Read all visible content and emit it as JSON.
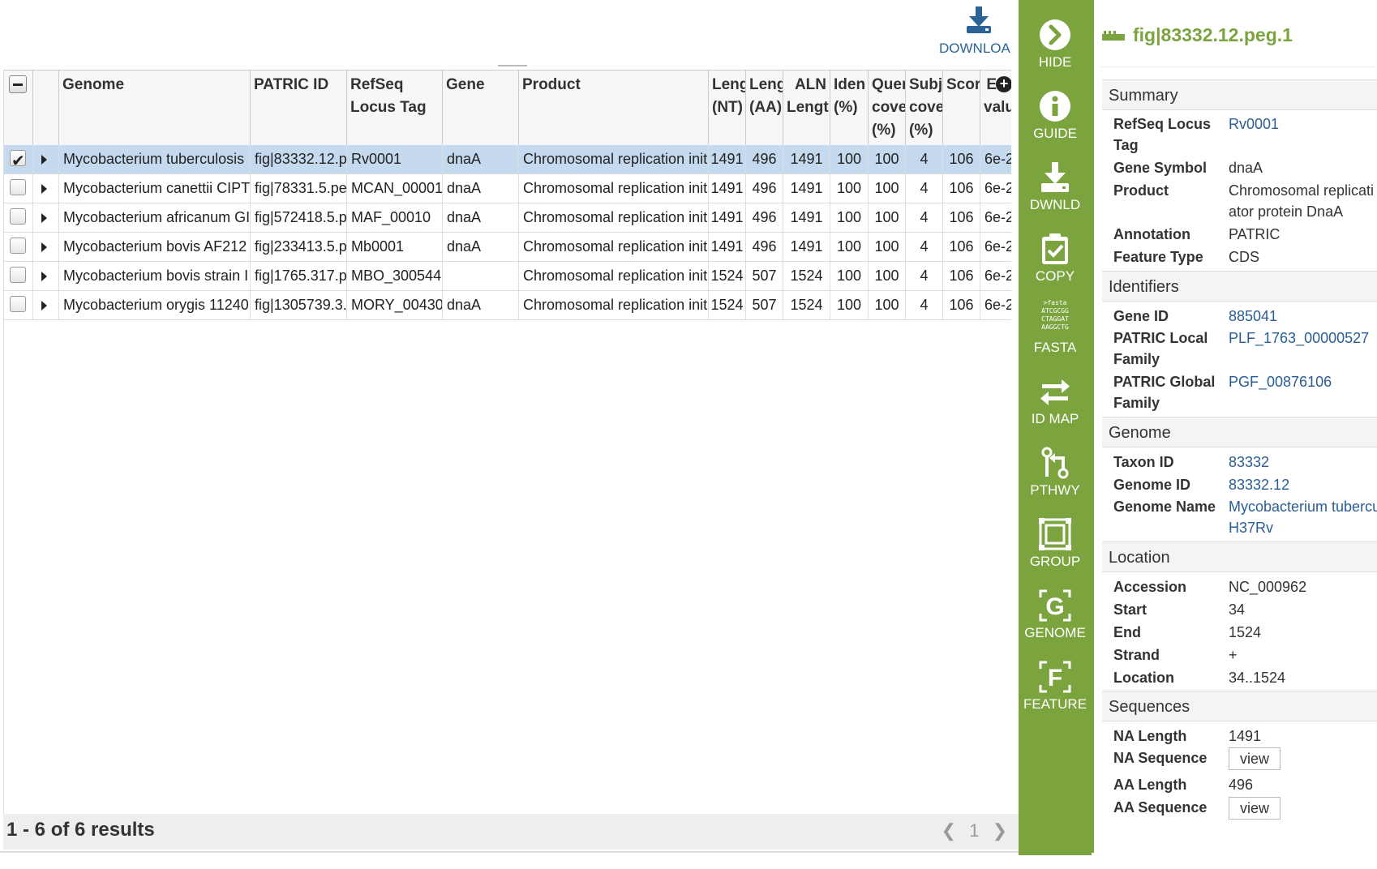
{
  "toolbar": {
    "download_label": "DOWNLOA"
  },
  "grid": {
    "columns": {
      "genome": "Genome",
      "patric_id": "PATRIC ID",
      "refseq_l1": "RefSeq",
      "refseq_l2": "Locus Tag",
      "gene": "Gene",
      "product": "Product",
      "len_nt_l1": "Leng",
      "len_nt_l2": "(NT)",
      "len_aa_l1": "Leng",
      "len_aa_l2": "(AA)",
      "aln_l1": "ALN",
      "aln_l2": "Lengt",
      "ident_l1": "Iden",
      "ident_l2": "(%)",
      "qcov_l1": "Quer",
      "qcov_l2": "cove",
      "qcov_l3": "(%)",
      "scov_l1": "Subj",
      "scov_l2": "cove",
      "scov_l3": "(%)",
      "score": "Scor",
      "evalue_l1": "E",
      "evalue_l2": "valu"
    },
    "rows": [
      {
        "genome": "Mycobacterium tuberculosis",
        "patric_id": "fig|83332.12.p",
        "refseq": "Rv0001",
        "gene": "dnaA",
        "product": "Chromosomal replication init",
        "len_nt": "1491",
        "len_aa": "496",
        "aln": "1491",
        "ident": "100",
        "qcov": "100",
        "scov": "4",
        "score": "106",
        "evalue": "6e-2"
      },
      {
        "genome": "Mycobacterium canettii CIPT",
        "patric_id": "fig|78331.5.pe",
        "refseq": "MCAN_00001",
        "gene": "dnaA",
        "product": "Chromosomal replication init",
        "len_nt": "1491",
        "len_aa": "496",
        "aln": "1491",
        "ident": "100",
        "qcov": "100",
        "scov": "4",
        "score": "106",
        "evalue": "6e-2"
      },
      {
        "genome": "Mycobacterium africanum GI",
        "patric_id": "fig|572418.5.p",
        "refseq": "MAF_00010",
        "gene": "dnaA",
        "product": "Chromosomal replication init",
        "len_nt": "1491",
        "len_aa": "496",
        "aln": "1491",
        "ident": "100",
        "qcov": "100",
        "scov": "4",
        "score": "106",
        "evalue": "6e-2"
      },
      {
        "genome": "Mycobacterium bovis AF212",
        "patric_id": "fig|233413.5.p",
        "refseq": "Mb0001",
        "gene": "dnaA",
        "product": "Chromosomal replication init",
        "len_nt": "1491",
        "len_aa": "496",
        "aln": "1491",
        "ident": "100",
        "qcov": "100",
        "scov": "4",
        "score": "106",
        "evalue": "6e-2"
      },
      {
        "genome": "Mycobacterium bovis strain I",
        "patric_id": "fig|1765.317.p",
        "refseq": "MBO_300544",
        "gene": "",
        "product": "Chromosomal replication init",
        "len_nt": "1524",
        "len_aa": "507",
        "aln": "1524",
        "ident": "100",
        "qcov": "100",
        "scov": "4",
        "score": "106",
        "evalue": "6e-2"
      },
      {
        "genome": "Mycobacterium orygis 11240",
        "patric_id": "fig|1305739.3.",
        "refseq": "MORY_00430",
        "gene": "dnaA",
        "product": "Chromosomal replication init",
        "len_nt": "1524",
        "len_aa": "507",
        "aln": "1524",
        "ident": "100",
        "qcov": "100",
        "scov": "4",
        "score": "106",
        "evalue": "6e-2"
      }
    ]
  },
  "footer": {
    "result_count": "1 - 6 of 6 results",
    "page": "1",
    "prev": "❮",
    "next": "❯"
  },
  "actions": {
    "hide": "HIDE",
    "guide": "GUIDE",
    "dwnld": "DWNLD",
    "copy": "COPY",
    "fasta": "FASTA",
    "fasta_icon": ">fasta\nATCGCGG\nCTAGGAT\nAAGGCTG",
    "idmap": "ID MAP",
    "pthwy": "PTHWY",
    "group": "GROUP",
    "genome": "GENOME",
    "feature": "FEATURE"
  },
  "panel": {
    "title": "fig|83332.12.peg.1",
    "summary": {
      "heading": "Summary",
      "refseq_k1": "RefSeq Locus",
      "refseq_k2": "Tag",
      "refseq_v": "Rv0001",
      "gene_symbol_k": "Gene Symbol",
      "gene_symbol_v": "dnaA",
      "product_k": "Product",
      "product_v1": "Chromosomal replicati",
      "product_v2": "ator protein DnaA",
      "annotation_k": "Annotation",
      "annotation_v": "PATRIC",
      "feature_type_k": "Feature Type",
      "feature_type_v": "CDS"
    },
    "identifiers": {
      "heading": "Identifiers",
      "gene_id_k": "Gene ID",
      "gene_id_v": "885041",
      "plf_k1": "PATRIC Local",
      "plf_k2": "Family",
      "plf_v": "PLF_1763_00000527",
      "pgf_k1": "PATRIC Global",
      "pgf_k2": "Family",
      "pgf_v": "PGF_00876106"
    },
    "genome": {
      "heading": "Genome",
      "taxon_k": "Taxon ID",
      "taxon_v": "83332",
      "genome_id_k": "Genome ID",
      "genome_id_v": "83332.12",
      "genome_name_k": "Genome Name",
      "genome_name_v1": "Mycobacterium tubercu",
      "genome_name_v2": "H37Rv"
    },
    "location": {
      "heading": "Location",
      "accession_k": "Accession",
      "accession_v": "NC_000962",
      "start_k": "Start",
      "start_v": "34",
      "end_k": "End",
      "end_v": "1524",
      "strand_k": "Strand",
      "strand_v": "+",
      "location_k": "Location",
      "location_v": "34..1524"
    },
    "sequences": {
      "heading": "Sequences",
      "na_len_k": "NA Length",
      "na_len_v": "1491",
      "na_seq_k": "NA Sequence",
      "na_seq_btn": "view",
      "aa_len_k": "AA Length",
      "aa_len_v": "496",
      "aa_seq_k": "AA Sequence",
      "aa_seq_btn": "view"
    }
  },
  "colors": {
    "accent_green": "#7ba43e",
    "link_blue": "#2a5d95",
    "selected_row": "#c5d9ef"
  }
}
